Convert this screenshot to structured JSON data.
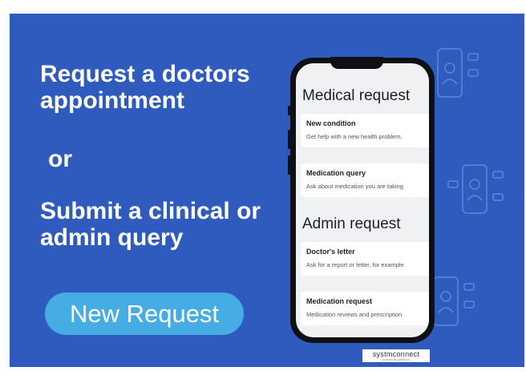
{
  "headline_1": "Request a doctors appointment",
  "or": "or",
  "headline_2": "Submit a clinical or admin query",
  "cta_label": "New Request",
  "phone": {
    "section_1": "Medical request",
    "section_2": "Admin request",
    "items": [
      {
        "title": "New condition",
        "subtitle": "Get help with a new health problem."
      },
      {
        "title": "Medication query",
        "subtitle": "Ask about medication you are taking"
      },
      {
        "title": "Doctor's letter",
        "subtitle": "Ask for a report or letter, for example"
      },
      {
        "title": "Medication request",
        "subtitle": "Medication reviews and prescription"
      }
    ]
  },
  "logo": {
    "name": "systmconnect",
    "sub": "powered by systmone"
  },
  "colors": {
    "background": "#2e5bbd",
    "button": "#45ace4",
    "phone_body": "#0f1013"
  },
  "icons": [
    "phone-doctor-icon",
    "chat-bubble-icon"
  ]
}
